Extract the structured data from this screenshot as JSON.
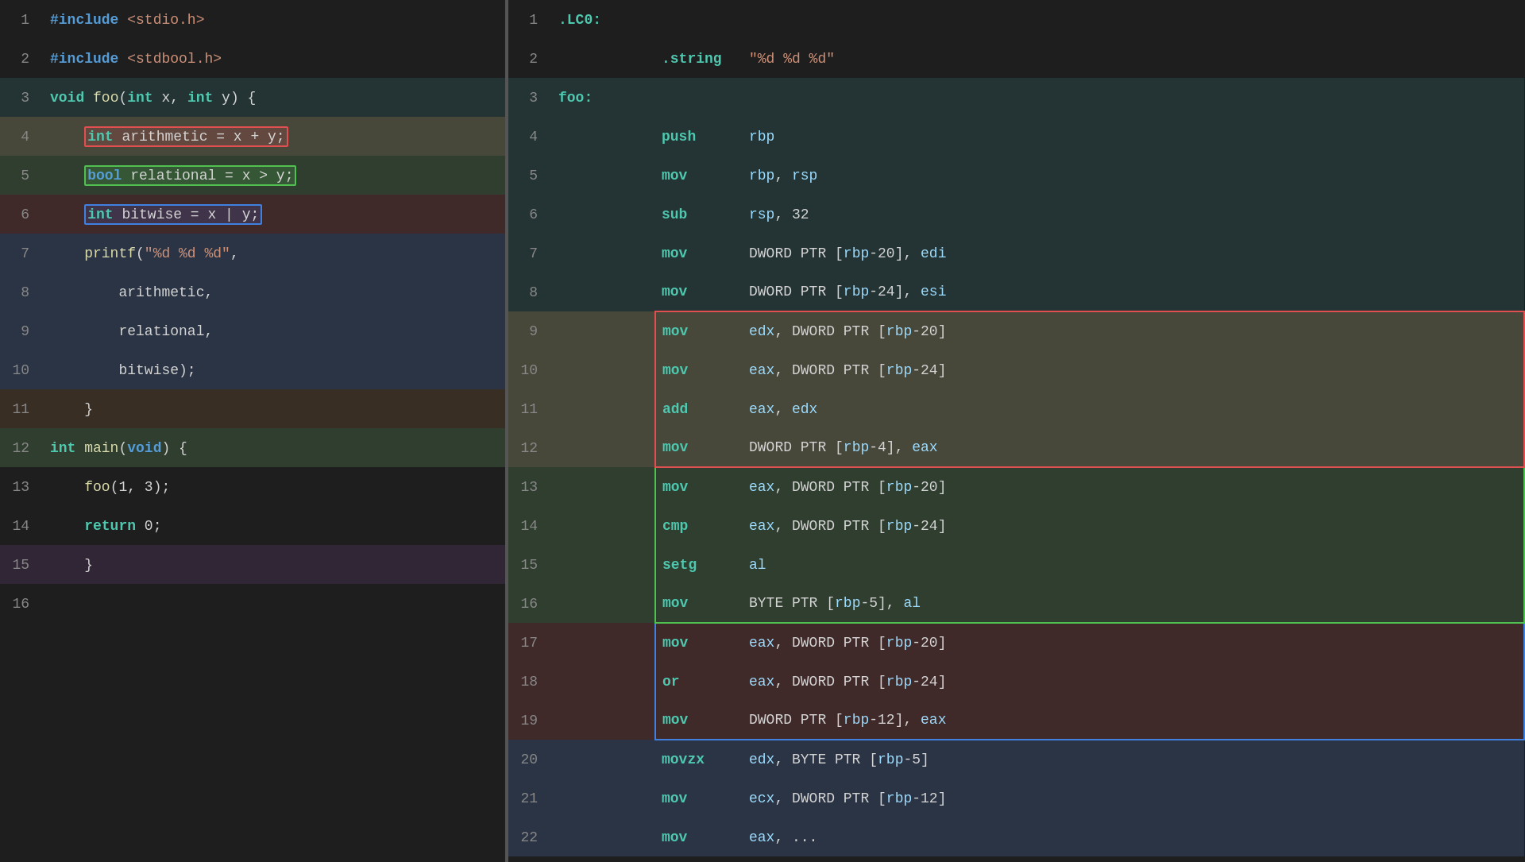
{
  "left": {
    "lines": [
      {
        "num": 1,
        "bg": "",
        "content": "#include <stdio.h>"
      },
      {
        "num": 2,
        "bg": "",
        "content": "#include <stdbool.h>"
      },
      {
        "num": 3,
        "bg": "bg-teal",
        "content": "void foo(int x, int y) {"
      },
      {
        "num": 4,
        "bg": "bg-yellow",
        "content": "    int arithmetic = x + y;",
        "highlight": "red"
      },
      {
        "num": 5,
        "bg": "bg-green",
        "content": "    bool relational = x > y;",
        "highlight": "green"
      },
      {
        "num": 6,
        "bg": "bg-red",
        "content": "    int bitwise = x | y;",
        "highlight": "blue"
      },
      {
        "num": 7,
        "bg": "bg-blue",
        "content": "    printf(\"%d %d %d\","
      },
      {
        "num": 8,
        "bg": "bg-blue",
        "content": "        arithmetic,"
      },
      {
        "num": 9,
        "bg": "bg-blue",
        "content": "        relational,"
      },
      {
        "num": 10,
        "bg": "bg-blue",
        "content": "        bitwise);"
      },
      {
        "num": 11,
        "bg": "bg-orange",
        "content": "    }"
      },
      {
        "num": 12,
        "bg": "bg-green",
        "content": "int main(void) {"
      },
      {
        "num": 13,
        "bg": "",
        "content": "    foo(1, 3);"
      },
      {
        "num": 14,
        "bg": "",
        "content": "    return 0;"
      },
      {
        "num": 15,
        "bg": "bg-purple",
        "content": "    }"
      },
      {
        "num": 16,
        "bg": "",
        "content": ""
      }
    ]
  },
  "right": {
    "lines": [
      {
        "num": 1,
        "bg": "",
        "label": ".LC0:",
        "op": "",
        "args": ""
      },
      {
        "num": 2,
        "bg": "",
        "label": "",
        "op": ".string",
        "args": "\"%d %d %d\""
      },
      {
        "num": 3,
        "bg": "bg-teal",
        "label": "foo:",
        "op": "",
        "args": ""
      },
      {
        "num": 4,
        "bg": "bg-teal",
        "label": "",
        "op": "push",
        "args": "rbp"
      },
      {
        "num": 5,
        "bg": "bg-teal",
        "label": "",
        "op": "mov",
        "args": "rbp, rsp"
      },
      {
        "num": 6,
        "bg": "bg-teal",
        "label": "",
        "op": "sub",
        "args": "rsp, 32"
      },
      {
        "num": 7,
        "bg": "bg-teal",
        "label": "",
        "op": "mov",
        "args": "DWORD PTR [rbp-20], edi"
      },
      {
        "num": 8,
        "bg": "bg-teal",
        "label": "",
        "op": "mov",
        "args": "DWORD PTR [rbp-24], esi"
      },
      {
        "num": 9,
        "bg": "bg-yellow",
        "label": "",
        "op": "mov",
        "args": "edx, DWORD PTR [rbp-20]",
        "borderTop": "red",
        "borderLeft": "red",
        "borderRight": "red"
      },
      {
        "num": 10,
        "bg": "bg-yellow",
        "label": "",
        "op": "mov",
        "args": "eax, DWORD PTR [rbp-24]",
        "borderLeft": "red",
        "borderRight": "red"
      },
      {
        "num": 11,
        "bg": "bg-yellow",
        "label": "",
        "op": "add",
        "args": "eax, edx",
        "borderLeft": "red",
        "borderRight": "red"
      },
      {
        "num": 12,
        "bg": "bg-yellow",
        "label": "",
        "op": "mov",
        "args": "DWORD PTR [rbp-4], eax",
        "borderBot": "red",
        "borderLeft": "red",
        "borderRight": "red"
      },
      {
        "num": 13,
        "bg": "bg-green",
        "label": "",
        "op": "mov",
        "args": "eax, DWORD PTR [rbp-20]",
        "borderTop": "green",
        "borderLeft": "green",
        "borderRight": "green"
      },
      {
        "num": 14,
        "bg": "bg-green",
        "label": "",
        "op": "cmp",
        "args": "eax, DWORD PTR [rbp-24]",
        "borderLeft": "green",
        "borderRight": "green"
      },
      {
        "num": 15,
        "bg": "bg-green",
        "label": "",
        "op": "setg",
        "args": "al",
        "borderLeft": "green",
        "borderRight": "green"
      },
      {
        "num": 16,
        "bg": "bg-green",
        "label": "",
        "op": "mov",
        "args": "BYTE PTR [rbp-5], al",
        "borderBot": "green",
        "borderLeft": "green",
        "borderRight": "green"
      },
      {
        "num": 17,
        "bg": "bg-red",
        "label": "",
        "op": "mov",
        "args": "eax, DWORD PTR [rbp-20]",
        "borderTop": "blue",
        "borderLeft": "blue",
        "borderRight": "blue"
      },
      {
        "num": 18,
        "bg": "bg-red",
        "label": "",
        "op": "or",
        "args": "eax, DWORD PTR [rbp-24]",
        "borderLeft": "blue",
        "borderRight": "blue"
      },
      {
        "num": 19,
        "bg": "bg-red",
        "label": "",
        "op": "mov",
        "args": "DWORD PTR [rbp-12], eax",
        "borderBot": "blue",
        "borderLeft": "blue",
        "borderRight": "blue"
      },
      {
        "num": 20,
        "bg": "bg-blue",
        "label": "",
        "op": "movzx",
        "args": "edx, BYTE PTR [rbp-5]"
      },
      {
        "num": 21,
        "bg": "bg-blue",
        "label": "",
        "op": "mov",
        "args": "ecx, DWORD PTR [rbp-12]"
      },
      {
        "num": 22,
        "bg": "bg-blue",
        "label": "",
        "op": "mov",
        "args": "eax, ..."
      }
    ]
  }
}
